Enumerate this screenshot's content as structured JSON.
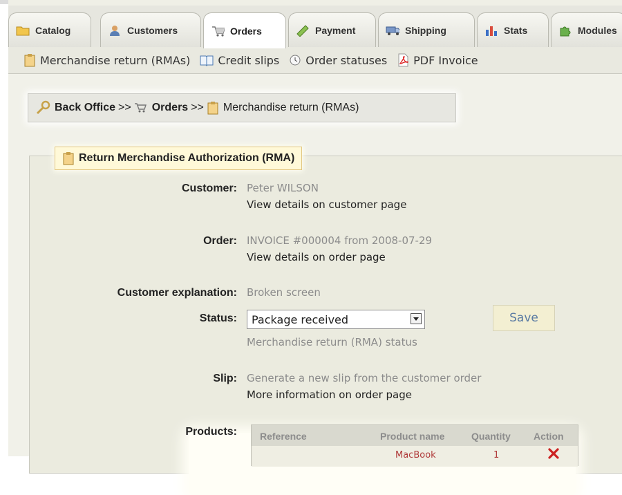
{
  "tabs": [
    {
      "label": "Catalog",
      "icon": "folder-icon"
    },
    {
      "label": "Customers",
      "icon": "customers-icon"
    },
    {
      "label": "Orders",
      "icon": "cart-icon",
      "active": true
    },
    {
      "label": "Payment",
      "icon": "payment-icon"
    },
    {
      "label": "Shipping",
      "icon": "truck-icon"
    },
    {
      "label": "Stats",
      "icon": "bar-chart-icon"
    },
    {
      "label": "Modules",
      "icon": "puzzle-icon"
    }
  ],
  "subnav": [
    {
      "label": "Merchandise return (RMAs)",
      "icon": "clipboard-icon"
    },
    {
      "label": "Credit slips",
      "icon": "book-icon"
    },
    {
      "label": "Order statuses",
      "icon": "clock-icon"
    },
    {
      "label": "PDF Invoice",
      "icon": "pdf-icon"
    }
  ],
  "breadcrumb": {
    "root": "Back Office",
    "sep": ">>",
    "section": "Orders",
    "current": "Merchandise return (RMAs)"
  },
  "rma": {
    "legend": "Return Merchandise Authorization (RMA)",
    "customer_label": "Customer:",
    "customer_name": "Peter WILSON",
    "customer_link": "View details on customer page",
    "order_label": "Order:",
    "order_value": "INVOICE #000004 from 2008-07-29",
    "order_link": "View details on order page",
    "explanation_label": "Customer explanation:",
    "explanation_value": "Broken screen",
    "status_label": "Status:",
    "status_selected": "Package received",
    "status_help": "Merchandise return (RMA) status",
    "save_label": "Save",
    "slip_label": "Slip:",
    "slip_value": "Generate a new slip from the customer order",
    "slip_link": "More information on order page",
    "products_label": "Products:"
  },
  "products_table": {
    "headers": [
      "Reference",
      "Product name",
      "Quantity",
      "Action"
    ],
    "rows": [
      {
        "product_name": "MacBook",
        "quantity": "1"
      }
    ]
  },
  "colors": {
    "accent_link": "#5a7ba3",
    "delete_red": "#cc2222",
    "legend_bg": "#fff9d8"
  }
}
